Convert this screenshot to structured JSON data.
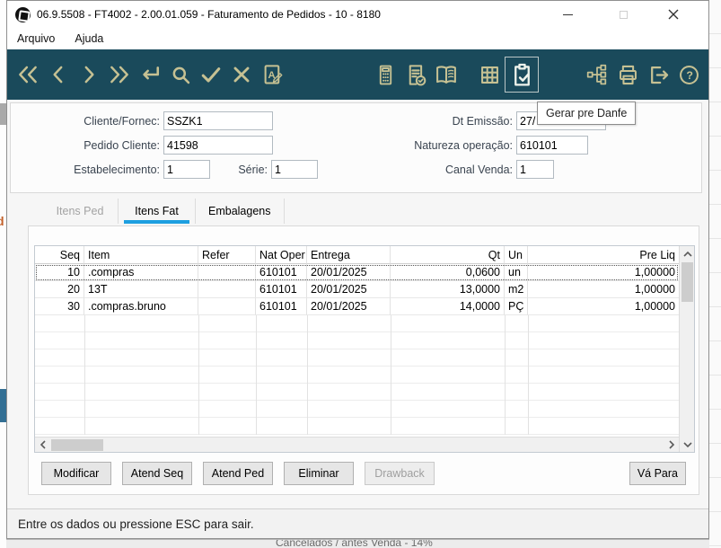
{
  "window": {
    "title": "06.9.5508 - FT4002 - 2.00.01.059 - Faturamento de Pedidos - 10 - 8180",
    "controls": [
      "minimize",
      "maximize",
      "close"
    ]
  },
  "menu": {
    "arquivo": "Arquivo",
    "ajuda": "Ajuda"
  },
  "toolbar": {
    "tooltip": "Gerar pre Danfe",
    "icon_names": [
      "first",
      "previous",
      "next",
      "last",
      "enter",
      "search",
      "confirm",
      "cancel",
      "edit-document",
      "calculator",
      "invoice-check",
      "catalog-book",
      "spreadsheet",
      "pre-danfe-clipboard",
      "structure-tree",
      "print",
      "exit",
      "help"
    ]
  },
  "form": {
    "cliente_label": "Cliente/Fornec:",
    "cliente_value": "SSZK1",
    "pedido_label": "Pedido Cliente:",
    "pedido_value": "41598",
    "estab_label": "Estabelecimento:",
    "estab_value": "1",
    "serie_label": "Série:",
    "serie_value": "1",
    "emissao_label": "Dt Emissão:",
    "emissao_value": "27/",
    "natureza_label": "Natureza operação:",
    "natureza_value": "610101",
    "canal_label": "Canal Venda:",
    "canal_value": "1"
  },
  "tabs": {
    "itens_ped": "Itens Ped",
    "itens_fat": "Itens Fat",
    "embalagens": "Embalagens"
  },
  "table": {
    "headers": {
      "seq": "Seq",
      "item": "Item",
      "refer": "Refer",
      "nat_oper": "Nat Oper",
      "entrega": "Entrega",
      "qt": "Qt",
      "un": "Un",
      "pre_liq": "Pre Liq"
    },
    "rows": [
      {
        "seq": "10",
        "item": ".compras",
        "refer": "",
        "nat_oper": "610101",
        "entrega": "20/01/2025",
        "qt": "0,0600",
        "un": "un",
        "pre_liq": "1,00000"
      },
      {
        "seq": "20",
        "item": "13T",
        "refer": "",
        "nat_oper": "610101",
        "entrega": "20/01/2025",
        "qt": "13,0000",
        "un": "m2",
        "pre_liq": "1,00000"
      },
      {
        "seq": "30",
        "item": ".compras.bruno",
        "refer": "",
        "nat_oper": "610101",
        "entrega": "20/01/2025",
        "qt": "14,0000",
        "un": "PÇ",
        "pre_liq": "1,00000"
      }
    ]
  },
  "buttons": {
    "modificar": "Modificar",
    "atend_seq": "Atend Seq",
    "atend_ped": "Atend Ped",
    "eliminar": "Eliminar",
    "drawback": "Drawback",
    "va_para": "Vá Para"
  },
  "statusbar": {
    "message": "Entre os dados ou pressione ESC para sair."
  },
  "background": {
    "left_edge_char": "d",
    "bottom_clipped_text": "Cancelados / antes Venda - 14%"
  }
}
